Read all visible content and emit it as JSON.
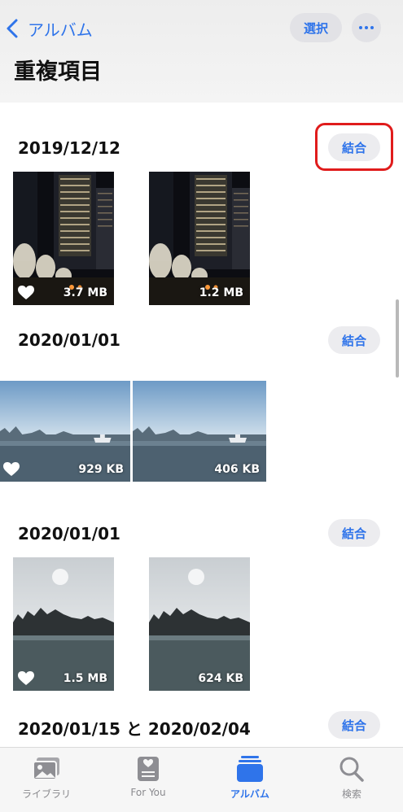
{
  "header": {
    "back_label": "アルバム",
    "select_label": "選択",
    "title": "重複項目"
  },
  "sections": [
    {
      "date": "2019/12/12",
      "merge_label": "結合",
      "photos": [
        {
          "size": "3.7 MB",
          "favorite": true,
          "scene": "city-night"
        },
        {
          "size": "1.2 MB",
          "favorite": false,
          "scene": "city-night"
        }
      ]
    },
    {
      "date": "2020/01/01",
      "merge_label": "結合",
      "photos": [
        {
          "size": "929 KB",
          "favorite": true,
          "scene": "bay-landscape"
        },
        {
          "size": "406 KB",
          "favorite": false,
          "scene": "bay-landscape"
        }
      ]
    },
    {
      "date": "2020/01/01",
      "merge_label": "結合",
      "photos": [
        {
          "size": "1.5 MB",
          "favorite": true,
          "scene": "bay-portrait"
        },
        {
          "size": "624 KB",
          "favorite": false,
          "scene": "bay-portrait"
        }
      ]
    },
    {
      "date": "2020/01/15 と 2020/02/04",
      "merge_label": "結合"
    }
  ],
  "tabbar": {
    "tabs": [
      {
        "label": "ライブラリ",
        "icon": "photos-library-icon",
        "active": false
      },
      {
        "label": "For You",
        "icon": "for-you-icon",
        "active": false
      },
      {
        "label": "アルバム",
        "icon": "albums-icon",
        "active": true
      },
      {
        "label": "検索",
        "icon": "search-icon",
        "active": false
      }
    ]
  },
  "colors": {
    "accent": "#2f74ea",
    "highlight": "#e01c1c"
  }
}
